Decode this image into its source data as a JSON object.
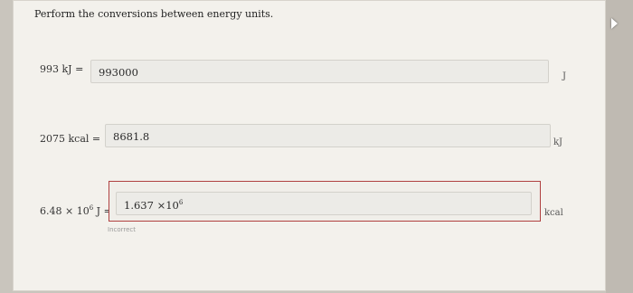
{
  "prompt": "Perform the conversions between energy units.",
  "rows": [
    {
      "lhs": "993 kJ =",
      "value": "993000",
      "unit": "J"
    },
    {
      "lhs": "2075 kcal =",
      "value": "8681.8",
      "unit": "kJ"
    },
    {
      "lhs_mantissa": "6.48 × 10",
      "lhs_exp": "6",
      "lhs_tail": " J =",
      "value_mantissa": "1.637  ×10",
      "value_exp": "6",
      "unit": "kcal",
      "status": "Incorrect"
    }
  ],
  "colors": {
    "error_border": "#b04040"
  }
}
